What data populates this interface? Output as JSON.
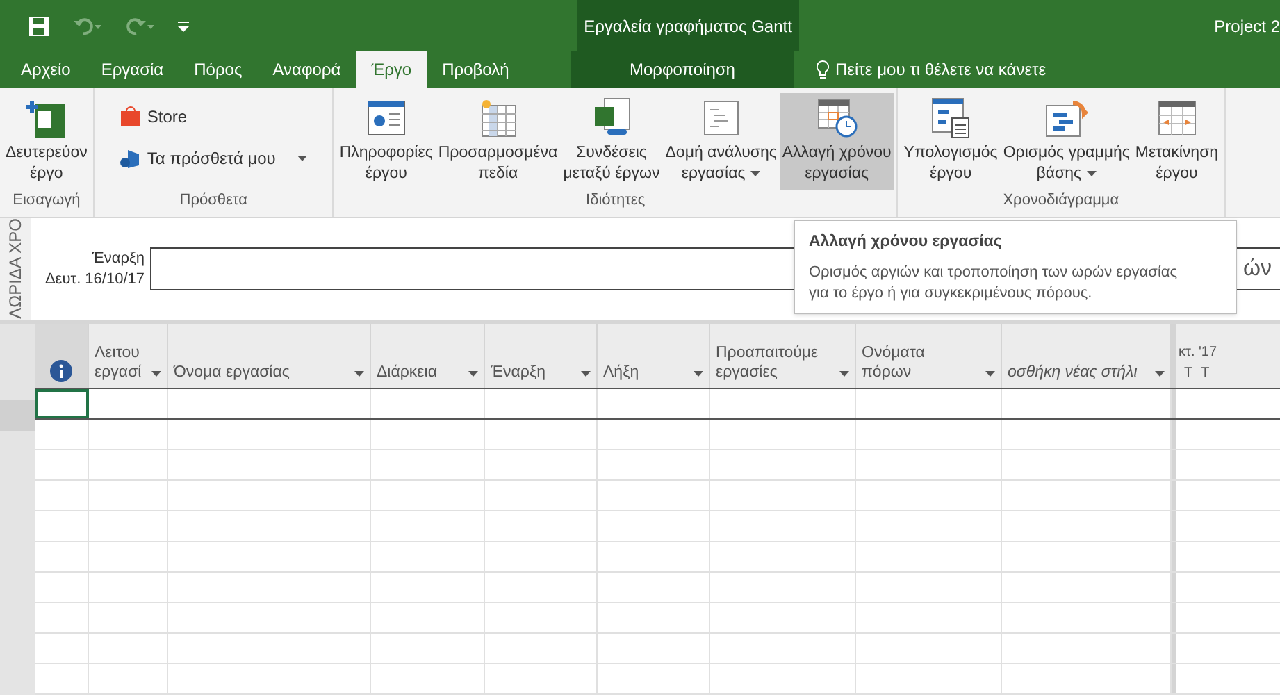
{
  "title_bar": {
    "contextual_title": "Εργαλεία γραφήματος Gantt",
    "app_title": "Project 2"
  },
  "tabs": [
    {
      "label": "Αρχείο",
      "selected": false
    },
    {
      "label": "Εργασία",
      "selected": false
    },
    {
      "label": "Πόρος",
      "selected": false
    },
    {
      "label": "Αναφορά",
      "selected": false
    },
    {
      "label": "Έργο",
      "selected": true
    },
    {
      "label": "Προβολή",
      "selected": false
    }
  ],
  "contextual_tab": {
    "label": "Μορφοποίηση",
    "selected": false
  },
  "tell_me": {
    "placeholder": "Πείτε μου τι θέλετε να κάνετε"
  },
  "ribbon_groups": [
    {
      "label": "Εισαγωγή",
      "buttons": [
        {
          "kind": "large",
          "label": "Δευτερεύον\nέργο",
          "menu": false,
          "highlighted": false
        }
      ]
    },
    {
      "label": "Πρόσθετα",
      "buttons": [
        {
          "kind": "small",
          "label": "Store",
          "menu": false,
          "highlighted": false
        },
        {
          "kind": "small",
          "label": "Τα πρόσθετά μου",
          "menu": true,
          "highlighted": false
        }
      ]
    },
    {
      "label": "Ιδιότητες",
      "buttons": [
        {
          "kind": "large",
          "label": "Πληροφορίες\nέργου",
          "menu": false,
          "highlighted": false
        },
        {
          "kind": "large",
          "label": "Προσαρμοσμένα\nπεδία",
          "menu": false,
          "highlighted": false
        },
        {
          "kind": "large",
          "label": "Συνδέσεις\nμεταξύ έργων",
          "menu": false,
          "highlighted": false
        },
        {
          "kind": "large",
          "label": "Δομή ανάλυσης\nεργασίας",
          "menu": true,
          "highlighted": false
        },
        {
          "kind": "large",
          "label": "Αλλαγή χρόνου\nεργασίας",
          "menu": false,
          "highlighted": true
        }
      ]
    },
    {
      "label": "Χρονοδιάγραμμα",
      "buttons": [
        {
          "kind": "large",
          "label": "Υπολογισμός\nέργου",
          "menu": false,
          "highlighted": false
        },
        {
          "kind": "large",
          "label": "Ορισμός γραμμής\nβάσης",
          "menu": true,
          "highlighted": false
        },
        {
          "kind": "large",
          "label": "Μετακίνηση\nέργου",
          "menu": false,
          "highlighted": false
        }
      ]
    }
  ],
  "timeline": {
    "side_label": "ΛΩΡΙΔΑ ΧΡΟ",
    "start_label": "Έναρξη",
    "start_date": "Δευτ. 16/10/17",
    "bar_text": "ών"
  },
  "tooltip": {
    "title": "Αλλαγή χρόνου εργασίας",
    "text": "Ορισμός αργιών και τροποποίηση των ωρών εργασίας για το έργο ή για συγκεκριμένους πόρους."
  },
  "table": {
    "columns": [
      {
        "kind": "info",
        "selected": true
      },
      {
        "kind": "text",
        "label": "Λειτου\nεργασί",
        "selected": false
      },
      {
        "kind": "text",
        "label": "Όνομα εργασίας",
        "selected": false
      },
      {
        "kind": "text",
        "label": "Διάρκεια",
        "selected": false
      },
      {
        "kind": "text",
        "label": "Έναρξη",
        "selected": false
      },
      {
        "kind": "text",
        "label": "Λήξη",
        "selected": false
      },
      {
        "kind": "text",
        "label": "Προαπαιτούμε\nεργασίες",
        "selected": false
      },
      {
        "kind": "text",
        "label": "Ονόματα\nπόρων",
        "selected": false
      },
      {
        "kind": "add",
        "label": "οσθήκη νέας στήλι",
        "selected": false
      }
    ]
  },
  "gantt": {
    "month": "κτ. '17",
    "days": [
      "Τ",
      "Τ"
    ]
  }
}
